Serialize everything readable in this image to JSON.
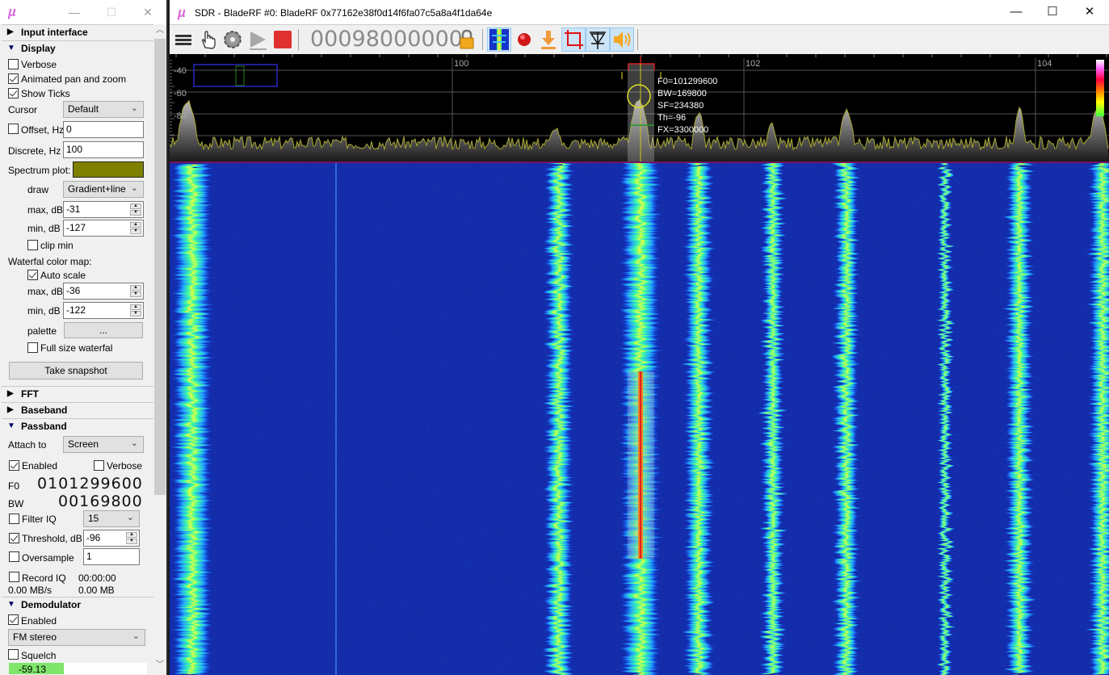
{
  "left_window": {
    "logo": "µ",
    "window_buttons": {
      "minimize": "—",
      "maximize": "☐",
      "close": "✕"
    },
    "sections": {
      "input_interface": {
        "label": "Input interface",
        "expanded": false
      },
      "display": {
        "label": "Display",
        "expanded": true,
        "verbose": {
          "label": "Verbose",
          "checked": false
        },
        "animated": {
          "label": "Animated pan and zoom",
          "checked": true
        },
        "show_ticks": {
          "label": "Show Ticks",
          "checked": true
        },
        "cursor": {
          "label": "Cursor",
          "value": "Default"
        },
        "offset": {
          "label": "Offset, Hz",
          "checked": false,
          "value": "0"
        },
        "discrete": {
          "label": "Discrete, Hz",
          "value": "100"
        },
        "spectrum_plot": {
          "label": "Spectrum plot:",
          "color": "#808000"
        },
        "draw": {
          "label": "draw",
          "value": "Gradient+line"
        },
        "max_db": {
          "label": "max, dB",
          "value": "-31"
        },
        "min_db": {
          "label": "min, dB",
          "value": "-127"
        },
        "clip_min": {
          "label": "clip min",
          "checked": false
        },
        "waterfall_label": "Waterfal color map:",
        "auto_scale": {
          "label": "Auto scale",
          "checked": true
        },
        "wf_max_db": {
          "label": "max, dB",
          "value": "-36"
        },
        "wf_min_db": {
          "label": "min, dB",
          "value": "-122"
        },
        "palette": {
          "label": "palette",
          "button": "..."
        },
        "full_size": {
          "label": "Full size waterfal",
          "checked": false
        },
        "snapshot": "Take snapshot"
      },
      "fft": {
        "label": "FFT",
        "expanded": false
      },
      "baseband": {
        "label": "Baseband",
        "expanded": false
      },
      "passband": {
        "label": "Passband",
        "expanded": true,
        "attach": {
          "label": "Attach to",
          "value": "Screen"
        },
        "enabled": {
          "label": "Enabled",
          "checked": true
        },
        "verbose": {
          "label": "Verbose",
          "checked": false
        },
        "f0": {
          "label": "F0",
          "value": "0101299600"
        },
        "bw": {
          "label": "BW",
          "value": "00169800"
        },
        "filter_iq": {
          "label": "Filter IQ",
          "checked": false,
          "value": "15"
        },
        "threshold": {
          "label": "Threshold, dB",
          "checked": true,
          "value": "-96"
        },
        "oversample": {
          "label": "Oversample",
          "checked": false,
          "value": "1"
        },
        "record_iq": {
          "label": "Record IQ",
          "checked": false,
          "time": "00:00:00"
        },
        "rate": "0.00 MB/s",
        "size": "0.00 MB"
      },
      "demodulator": {
        "label": "Demodulator",
        "expanded": true,
        "enabled": {
          "label": "Enabled",
          "checked": true
        },
        "mode": "FM stereo",
        "squelch": {
          "label": "Squelch",
          "checked": false
        },
        "level": "-59.13",
        "level_fraction": 0.4
      }
    }
  },
  "main_window": {
    "logo": "µ",
    "title": "SDR - BladeRF #0: BladeRF 0x77162e38f0d14f6fa07c5a8a4f1da64e",
    "window_buttons": {
      "minimize": "—",
      "maximize": "☐",
      "close": "✕"
    },
    "toolbar": {
      "frequency": "00098000000",
      "icons": [
        "menu-icon",
        "hand-icon",
        "gear-icon",
        "play-icon",
        "stop-icon",
        "lock-icon",
        "waterfall-icon",
        "record-icon",
        "download-icon",
        "crop-icon",
        "diode-icon",
        "speaker-icon"
      ]
    },
    "spectrum": {
      "y_ticks": [
        "-40",
        "-60",
        "-80"
      ],
      "x_ticks": [
        "100",
        "102",
        "104"
      ],
      "passband_info": [
        "F0=101299600",
        "BW=169800",
        "SF=234380",
        "Th=-96",
        "FX=3300000"
      ],
      "line_color": "#a0a030"
    }
  }
}
